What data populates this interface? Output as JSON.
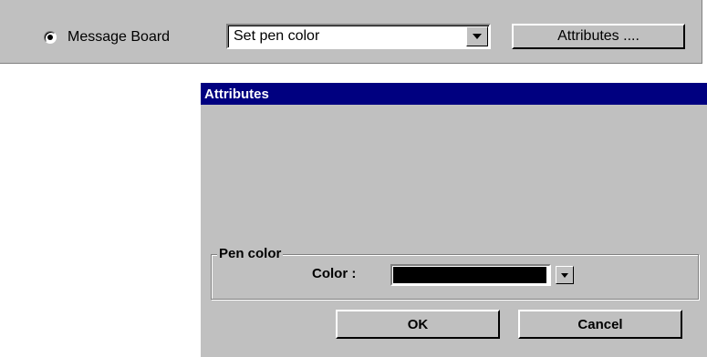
{
  "toolbar": {
    "radio_label": "Message Board",
    "radio_checked": true,
    "command_select_value": "Set pen color",
    "attributes_button_label": "Attributes ...."
  },
  "dialog": {
    "title": "Attributes",
    "pen_group": {
      "legend": "Pen color",
      "color_label": "Color :",
      "selected_color": "#000000"
    },
    "ok_label": "OK",
    "cancel_label": "Cancel"
  },
  "colors": {
    "face": "#c0c0c0",
    "titlebar": "#000080",
    "titlebar_text": "#ffffff"
  },
  "icons": {
    "radio": "radio-selected-icon",
    "dropdown": "chevron-down-icon"
  }
}
